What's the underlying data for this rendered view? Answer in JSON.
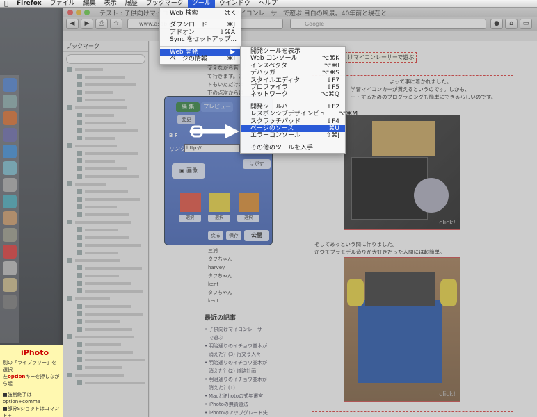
{
  "menubar": {
    "app": "Firefox",
    "items": [
      "ファイル",
      "編集",
      "表示",
      "履歴",
      "ブックマーク",
      "ツール",
      "ウインドウ",
      "ヘルプ"
    ],
    "active_index": 5
  },
  "window": {
    "tab_title": "テスト : 子供向けマイコンレーサー",
    "tab_title_right": "けマイコンレーサーで遊ぶ 目白の風景。40年前と現在と",
    "url": "www.asablo.jp/app/c",
    "search_placeholder": "Google"
  },
  "sidebar": {
    "header": "ブックマーク"
  },
  "tools_menu": {
    "items": [
      {
        "label": "Web 検索",
        "shortcut": "⌘K"
      },
      {
        "sep": true
      },
      {
        "label": "ダウンロード",
        "shortcut": "⌘J"
      },
      {
        "label": "アドオン",
        "shortcut": "⇧⌘A"
      },
      {
        "label": "Sync をセットアップ...",
        "shortcut": ""
      },
      {
        "sep": true
      },
      {
        "label": "Web 開発",
        "shortcut": "▶",
        "highlight": true
      },
      {
        "label": "ページの情報",
        "shortcut": "⌘I"
      }
    ]
  },
  "webdev_menu": {
    "items": [
      {
        "label": "開発ツールを表示",
        "shortcut": ""
      },
      {
        "label": "Web コンソール",
        "shortcut": "⌥⌘K"
      },
      {
        "label": "インスペクタ",
        "shortcut": "⌥⌘I"
      },
      {
        "label": "デバッガ",
        "shortcut": "⌥⌘S"
      },
      {
        "label": "スタイルエディタ",
        "shortcut": "⇧F7"
      },
      {
        "label": "プロファイラ",
        "shortcut": "⇧F5"
      },
      {
        "label": "ネットワーク",
        "shortcut": "⌥⌘Q"
      },
      {
        "sep": true
      },
      {
        "label": "開発ツールバー",
        "shortcut": "⇧F2"
      },
      {
        "label": "レスポンシブデザインビュー",
        "shortcut": "⌥⌘M"
      },
      {
        "label": "スクラッチパッド",
        "shortcut": "⇧F4"
      },
      {
        "label": "ページのソース",
        "shortcut": "⌘U",
        "highlight": true
      },
      {
        "label": "エラーコンソール",
        "shortcut": "⇧⌘J"
      },
      {
        "sep": true
      },
      {
        "label": "その他のツールを入手",
        "shortcut": ""
      }
    ]
  },
  "page": {
    "heading_box": "けマイコンレーサーで遊ぶ",
    "article_p1": "よって事に着かれました。",
    "article_p2": "学習マイコンカーが貰えるというのです。しかも、",
    "article_p3": "ートするためのプログラミングも簡単にできるらしいのです。",
    "caption2a": "そしてあっという間に作りました。",
    "caption2b": "かつてプラモデル造りが大好きだった人間には超簡単。",
    "click": "click!",
    "left_text": [
      "交えながら昔",
      "て行きます。こ",
      "トもいただけま",
      "下の点次からは"
    ],
    "comment_names": [
      "三浦",
      "タフちゃん",
      "harvey",
      "タフちゃん",
      "kent",
      "タフちゃん",
      "kent"
    ],
    "recent_title": "最近の記事",
    "recent_items": [
      "子供向けマイコンレーサーで遊ぶ",
      "明治通りのイチョウ並木が消えた？(3) 行交う人々",
      "明治通りのイチョウ並木が消えた？(2) 道路計画",
      "明治通りのイチョウ並木が消えた？(1)",
      "MacとiPhotoの式年遷宮",
      "iPhotoの無責道法",
      "iPhotoのアップグレード失敗で写真消失"
    ]
  },
  "widget": {
    "tab_edit": "編 集",
    "tab_preview": "プレビュー",
    "btn_change": "変更",
    "link_label": "リンク",
    "link_value": "http://",
    "btn_remove": "はがす",
    "btn_image": "画像",
    "btn_select": "選択",
    "btn_back": "戻る",
    "btn_save": "保存",
    "btn_publish": "公開"
  },
  "iphoto_note": {
    "title": "iPhoto",
    "line1": "別の「ライブラリー」を選択",
    "line2a": "左",
    "line2_opt": "option",
    "line2b": "キーを押しながら起",
    "line3": "■強制終了はoption+comma",
    "line4": "■部分Sショットはコマンド+"
  }
}
